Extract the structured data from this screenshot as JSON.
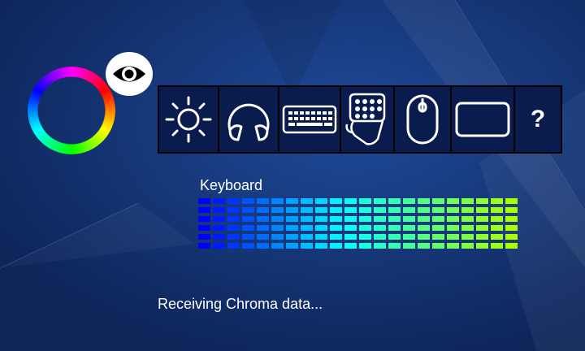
{
  "app": {
    "selected_device_label": "Keyboard",
    "status_text": "Receiving Chroma data..."
  },
  "toolbar": {
    "color_picker_icon": "color-wheel-icon",
    "visibility_icon": "eye-icon",
    "devices": [
      {
        "name": "sun-icon",
        "label": ""
      },
      {
        "name": "headset-icon",
        "label": ""
      },
      {
        "name": "keyboard-icon",
        "label": ""
      },
      {
        "name": "keypad-icon",
        "label": ""
      },
      {
        "name": "mouse-icon",
        "label": ""
      },
      {
        "name": "mousepad-icon",
        "label": ""
      },
      {
        "name": "help-icon",
        "label": "?"
      }
    ]
  },
  "led_preview": {
    "rows": 6,
    "columns": 22,
    "start_color": "#0000ff",
    "middle_color": "#00ffff",
    "end_color": "#aaff00"
  },
  "colors": {
    "background": "#0f2a63",
    "toolbar_bg": "#0a1b4d",
    "icon": "#ffffff"
  }
}
